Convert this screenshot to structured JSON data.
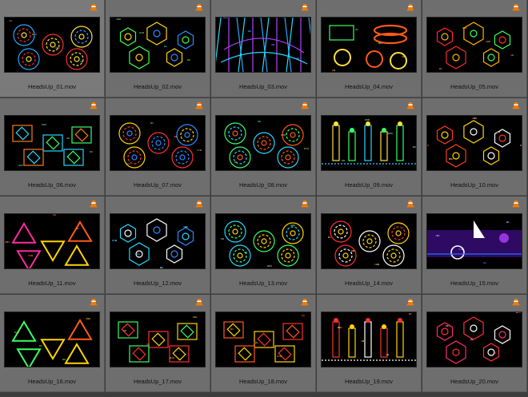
{
  "files": [
    {
      "name": "HeadsUp_01.mov",
      "palette": [
        "#2aa6ff",
        "#ff3030",
        "#ffe040"
      ],
      "style": "rings"
    },
    {
      "name": "HeadsUp_02.mov",
      "palette": [
        "#3cff4a",
        "#ffd400",
        "#2a8cff"
      ],
      "style": "hex"
    },
    {
      "name": "HeadsUp_03.mov",
      "palette": [
        "#27d7ff",
        "#b040ff",
        "#2aa6ff"
      ],
      "style": "lines"
    },
    {
      "name": "HeadsUp_04.mov",
      "palette": [
        "#ff5a1a",
        "#39ff66",
        "#ffe040"
      ],
      "style": "cylinders"
    },
    {
      "name": "HeadsUp_05.mov",
      "palette": [
        "#ff2a2a",
        "#ffb000",
        "#39ff66"
      ],
      "style": "hex"
    },
    {
      "name": "HeadsUp_06.mov",
      "palette": [
        "#ff7a1a",
        "#27d7ff",
        "#39ff66"
      ],
      "style": "boxes"
    },
    {
      "name": "HeadsUp_07.mov",
      "palette": [
        "#ffd400",
        "#ff3030",
        "#2a8cff"
      ],
      "style": "rings"
    },
    {
      "name": "HeadsUp_08.mov",
      "palette": [
        "#39ff66",
        "#27d7ff",
        "#ff5a1a"
      ],
      "style": "rings"
    },
    {
      "name": "HeadsUp_09.mov",
      "palette": [
        "#ffe040",
        "#39ff66",
        "#27d7ff"
      ],
      "style": "towers"
    },
    {
      "name": "HeadsUp_10.mov",
      "palette": [
        "#ff3a1a",
        "#ffd400",
        "#ffffff"
      ],
      "style": "hex"
    },
    {
      "name": "HeadsUp_11.mov",
      "palette": [
        "#ff2aa0",
        "#ffd400",
        "#ff5a1a"
      ],
      "style": "triangles"
    },
    {
      "name": "HeadsUp_12.mov",
      "palette": [
        "#27d7ff",
        "#ffffff",
        "#2a8cff"
      ],
      "style": "hex"
    },
    {
      "name": "HeadsUp_13.mov",
      "palette": [
        "#27d7ff",
        "#39ff66",
        "#ffd400"
      ],
      "style": "rings"
    },
    {
      "name": "HeadsUp_14.mov",
      "palette": [
        "#ff3030",
        "#ffffff",
        "#ffd400"
      ],
      "style": "rings"
    },
    {
      "name": "HeadsUp_15.mov",
      "palette": [
        "#b040ff",
        "#ffffff",
        "#2a6cff"
      ],
      "style": "purple"
    },
    {
      "name": "HeadsUp_16.mov",
      "palette": [
        "#39ff66",
        "#ffd400",
        "#ff5a1a"
      ],
      "style": "triangles"
    },
    {
      "name": "HeadsUp_17.mov",
      "palette": [
        "#39ff66",
        "#ff3030",
        "#ffd400"
      ],
      "style": "boxes"
    },
    {
      "name": "HeadsUp_18.mov",
      "palette": [
        "#ff5a1a",
        "#ffd400",
        "#ff3030"
      ],
      "style": "boxes"
    },
    {
      "name": "HeadsUp_19.mov",
      "palette": [
        "#ff3030",
        "#ffd400",
        "#ffffff"
      ],
      "style": "towers"
    },
    {
      "name": "HeadsUp_20.mov",
      "palette": [
        "#ff2a6a",
        "#ff3030",
        "#ffffff"
      ],
      "style": "hex"
    }
  ],
  "icon": "vlc-cone-icon",
  "colors": {
    "background": "#3c3c3c",
    "tile": "#6e6e6e",
    "vlc_orange": "#f07a00"
  }
}
